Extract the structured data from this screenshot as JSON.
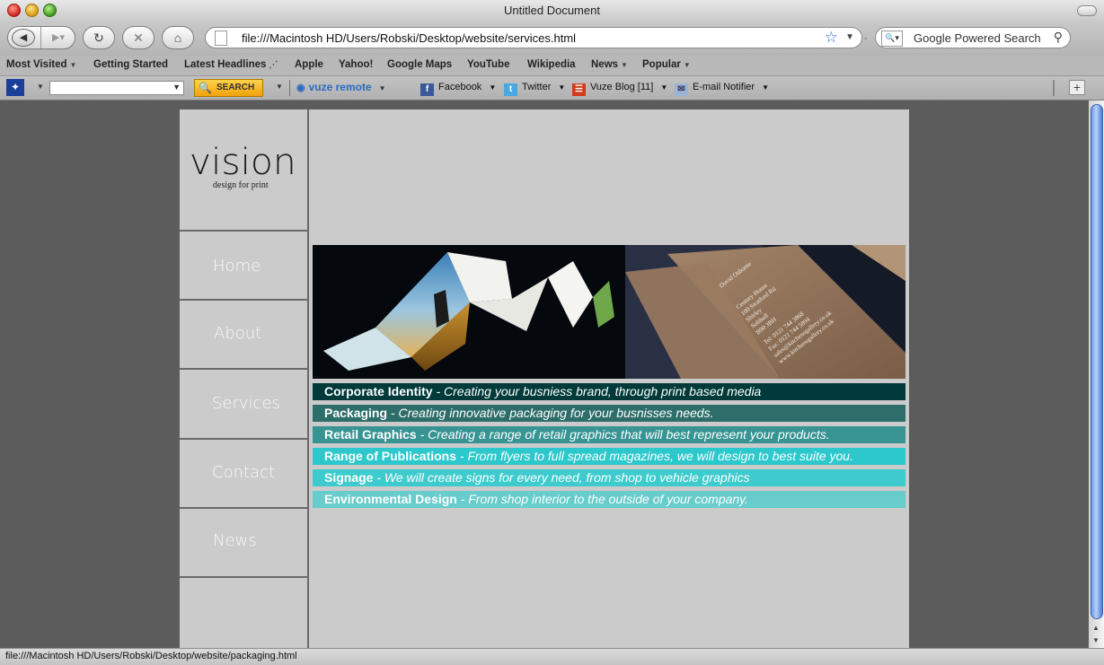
{
  "window": {
    "title": "Untitled Document"
  },
  "navigation": {
    "url": "file:///Macintosh HD/Users/Robski/Desktop/website/services.html",
    "search_placeholder": "Google Powered Search"
  },
  "bookmarks": [
    {
      "label": "Most Visited",
      "dropdown": true
    },
    {
      "label": "Getting Started",
      "dropdown": false
    },
    {
      "label": "Latest Headlines",
      "dropdown": false
    },
    {
      "label": "Apple",
      "dropdown": false
    },
    {
      "label": "Yahoo!",
      "dropdown": false
    },
    {
      "label": "Google Maps",
      "dropdown": false
    },
    {
      "label": "YouTube",
      "dropdown": false
    },
    {
      "label": "Wikipedia",
      "dropdown": false
    },
    {
      "label": "News",
      "dropdown": true
    },
    {
      "label": "Popular",
      "dropdown": true
    }
  ],
  "addon_toolbar": {
    "search_button": "SEARCH",
    "vuze_remote": "vuze remote",
    "facebook": "Facebook",
    "twitter": "Twitter",
    "vuze_blog": "Vuze Blog [11]",
    "email_notifier": "E-mail Notifier"
  },
  "site": {
    "logo_text": "vision",
    "tagline": "design for print",
    "nav": [
      {
        "label": "Home"
      },
      {
        "label": "About"
      },
      {
        "label": "Services"
      },
      {
        "label": "Contact"
      },
      {
        "label": "News"
      }
    ],
    "banner": {
      "card_name": "David Osborne",
      "card_lines": [
        "Century House",
        "100 Stratford Rd",
        "Shirley",
        "Solihull",
        "B90 3BH",
        "Tel: 0121 744 3868",
        "Fax: 0121 744 5894",
        "sales@kitchensgallery.co.uk",
        "www.kitchensgallery.co.uk"
      ]
    },
    "services": [
      {
        "name": "Corporate Identity",
        "desc": " - Creating your busniess brand, through print based media",
        "color": "#013a3a"
      },
      {
        "name": "Packaging",
        "desc": " - Creating innovative packaging for your busnisses needs.",
        "color": "#2e6e6a"
      },
      {
        "name": "Retail Graphics",
        "desc": " - Creating a range of retail graphics that will best represent your products.",
        "color": "#379493"
      },
      {
        "name": "Range of Publications",
        "desc": " - From flyers to full spread magazines, we will design to best suite you.",
        "color": "#2cc8cc"
      },
      {
        "name": "Signage",
        "desc": " - We will create signs for every need, from shop to vehicle graphics",
        "color": "#3ecbcd"
      },
      {
        "name": "Environmental Design",
        "desc": " - From shop interior to the outside of your company.",
        "color": "#67cccb"
      }
    ]
  },
  "status": {
    "text": "file:///Macintosh HD/Users/Robski/Desktop/website/packaging.html"
  }
}
